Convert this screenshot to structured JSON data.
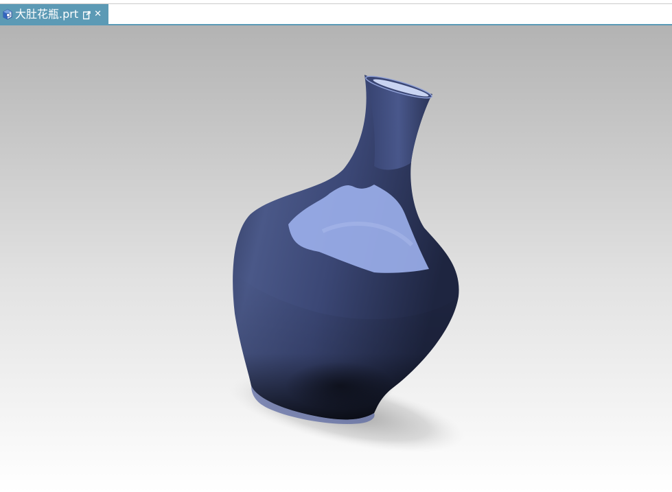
{
  "tab": {
    "title": "大肚花瓶.prt",
    "icon": "part-file-icon",
    "undock_icon": "undock-icon",
    "close_icon": "close-icon"
  },
  "viewport": {
    "model": "vase-3d-model",
    "background_top": "#b3b3b3",
    "background_bottom": "#ffffff",
    "model_color": "#3d4a78",
    "highlight_color": "#9aaee9",
    "accent": "#5c9ab5"
  }
}
